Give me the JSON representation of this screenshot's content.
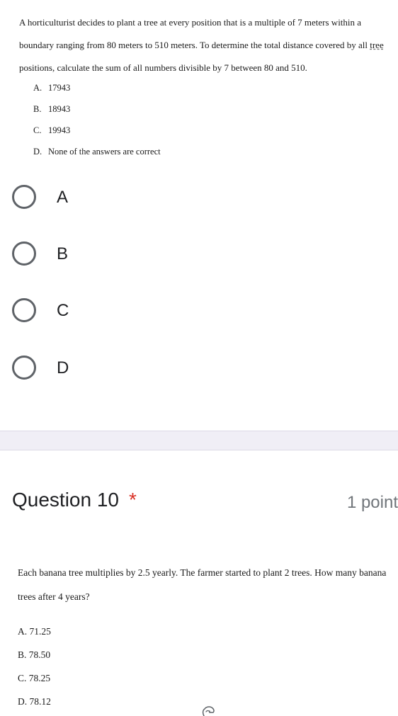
{
  "question9": {
    "text_part1": "A horticulturist decides to plant a tree at every position that is a multiple of 7 meters within a boundary ranging from 80 meters to 510 meters. To determine the total distance covered by all ",
    "text_underlined": "tree",
    "text_part2": " positions, calculate the sum of all numbers divisible by 7 between 80 and 510.",
    "options": [
      {
        "letter": "A.",
        "text": "17943"
      },
      {
        "letter": "B.",
        "text": "18943"
      },
      {
        "letter": "C.",
        "text": "19943"
      },
      {
        "letter": "D.",
        "text": "None of the answers are correct"
      }
    ],
    "choices": [
      "A",
      "B",
      "C",
      "D"
    ]
  },
  "question10": {
    "title": "Question 10",
    "required_marker": "*",
    "points": "1 point",
    "text": "Each banana tree multiplies by 2.5 yearly. The farmer started to plant 2 trees. How many banana trees after 4 years?",
    "options": [
      "A. 71.25",
      "B. 78.50",
      "C. 78.25",
      "D. 78.12"
    ]
  },
  "colors": {
    "radio_border": "#5f6368",
    "required_star": "#d93025",
    "divider_band": "#f0eef6",
    "points_text": "#70757a"
  },
  "icons": {
    "cursor": "hand-pointer-icon"
  }
}
